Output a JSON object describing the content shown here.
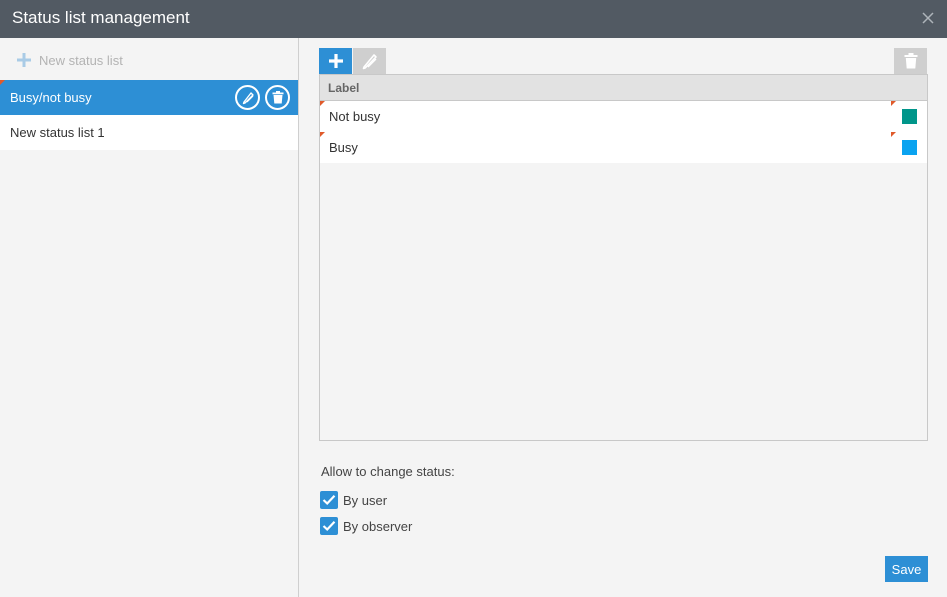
{
  "window": {
    "title": "Status list management"
  },
  "sidebar": {
    "new_button_label": "New status list",
    "items": [
      {
        "label": "Busy/not busy",
        "selected": true
      },
      {
        "label": "New status list 1",
        "selected": false
      }
    ]
  },
  "grid": {
    "column_label": "Label",
    "rows": [
      {
        "label": "Not busy",
        "color": "#00968a"
      },
      {
        "label": "Busy",
        "color": "#0aa3f0"
      }
    ]
  },
  "permissions": {
    "heading": "Allow to change status:",
    "by_user": {
      "label": "By user",
      "checked": true
    },
    "by_observer": {
      "label": "By observer",
      "checked": true
    }
  },
  "actions": {
    "save_label": "Save"
  },
  "colors": {
    "accent": "#2d8fd5",
    "titlebar": "#525a63",
    "marker": "#e05a2b"
  },
  "icons": {
    "close": "close-icon",
    "add": "plus-icon",
    "edit": "pencil-icon",
    "delete": "trash-icon"
  }
}
